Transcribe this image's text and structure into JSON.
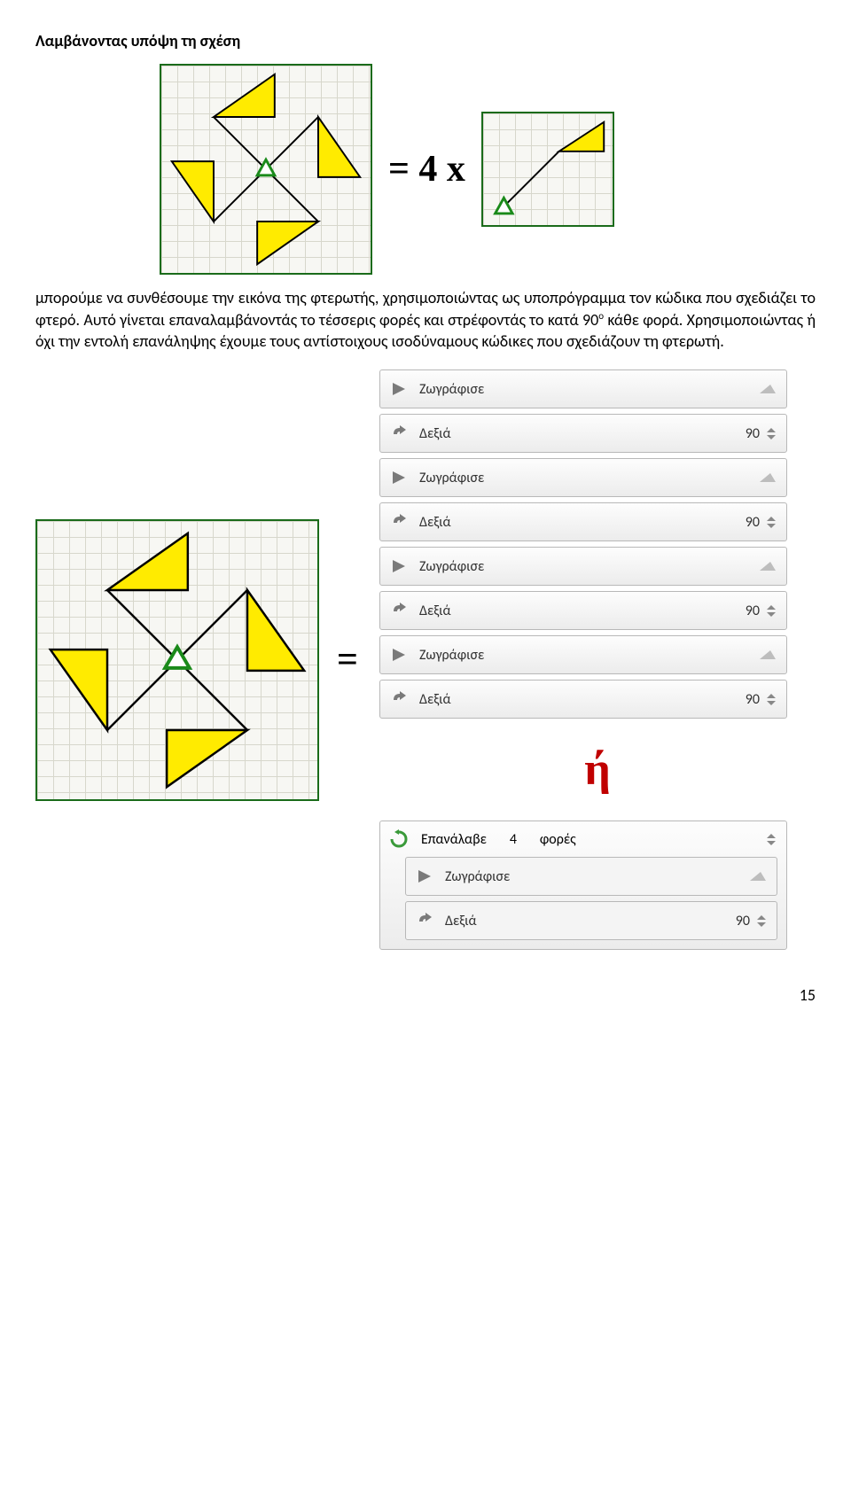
{
  "text": {
    "intro_bold": "Λαμβάνοντας υπόψη τη σχέση",
    "eq1": "=  4 x",
    "para2": "μπορούμε να συνθέσουμε την εικόνα της φτερωτής, χρησιμοποιώντας ως υποπρόγραμμα τον κώδικα που σχεδιάζει το φτερό. Αυτό γίνεται επαναλαμβάνοντάς το τέσσερις φορές και στρέφοντάς το κατά 90",
    "para2_sup": "ο",
    "para2_tail": " κάθε φορά. Χρησιμοποιώντας ή όχι την εντολή επανάληψης έχουμε τους αντίστοιχους ισοδύναμους κώδικες που σχεδιάζουν τη φτερωτή.",
    "eq2": "=",
    "or": "ή",
    "page": "15"
  },
  "commands": {
    "draw": "Ζωγράφισε",
    "right": "Δεξιά",
    "repeat_pre": "Επανάλαβε",
    "repeat_n": "4",
    "repeat_suf": "φορές",
    "val90": "90"
  }
}
